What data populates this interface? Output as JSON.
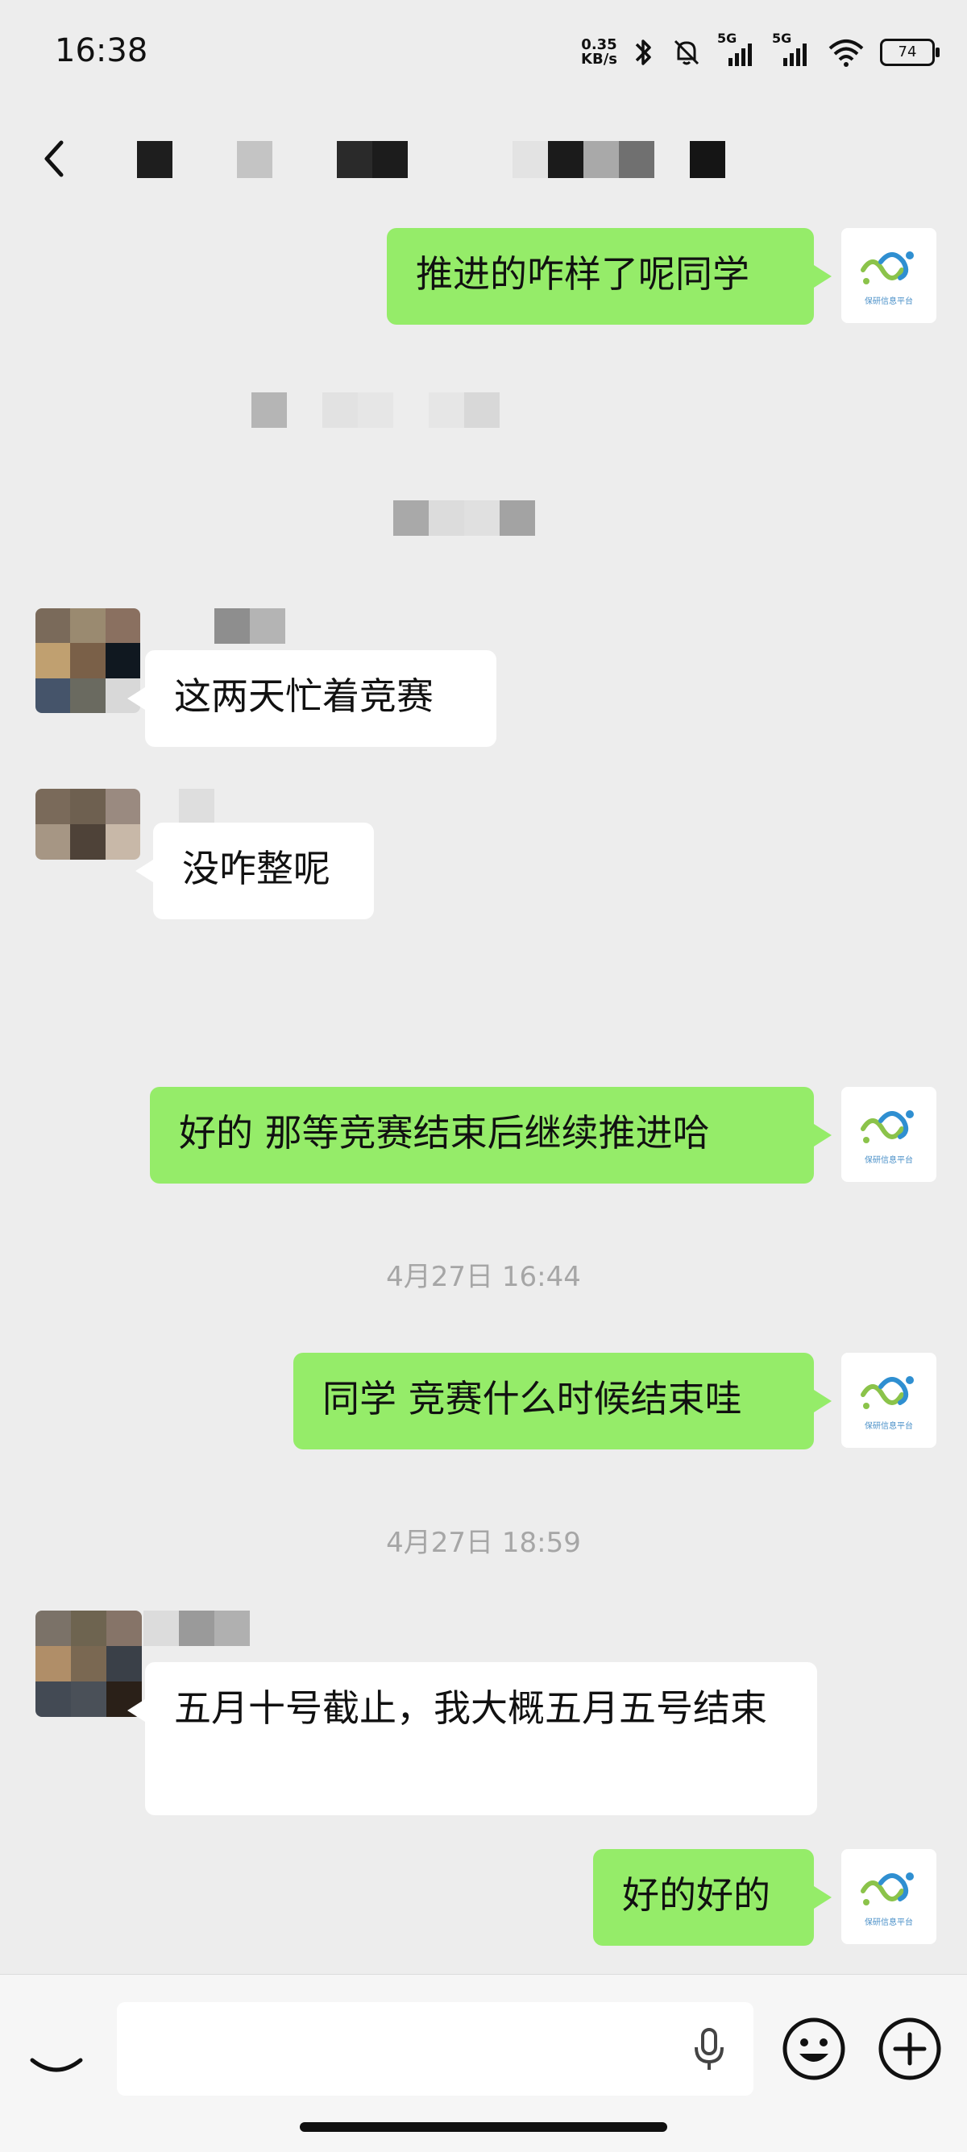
{
  "status_bar": {
    "time": "16:38",
    "net_speed_value": "0.35",
    "net_speed_unit": "KB/s",
    "sig1_label": "5G",
    "sig2_label": "5G",
    "battery": "74"
  },
  "header": {
    "back_icon": "chevron-left-icon"
  },
  "messages": [
    {
      "side": "me",
      "text": "推进的咋样了呢同学"
    },
    {
      "side": "them",
      "text": "这两天忙着竞赛"
    },
    {
      "side": "them",
      "text": "没咋整呢"
    },
    {
      "side": "me",
      "text": "好的 那等竞赛结束后继续推进哈"
    },
    {
      "side": "me",
      "text": "同学 竞赛什么时候结束哇"
    },
    {
      "side": "them",
      "text": "五月十号截止，我大概五月五号结束"
    },
    {
      "side": "me",
      "text": "好的好的"
    }
  ],
  "timestamps": [
    "4月27日 16:44",
    "4月27日 18:59"
  ],
  "self_avatar": {
    "logo_text": "保研信息平台"
  },
  "input_bar": {
    "placeholder": "",
    "voice_icon": "voice-icon",
    "mic_icon": "microphone-icon",
    "emoji_icon": "emoji-icon",
    "plus_icon": "plus-icon"
  },
  "colors": {
    "background": "#ededed",
    "my_bubble": "#95ec69",
    "their_bubble": "#ffffff"
  }
}
